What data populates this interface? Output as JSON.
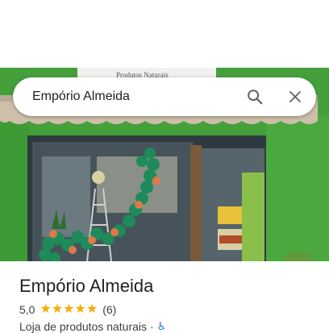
{
  "search": {
    "query": "Empório Almeida",
    "search_icon": "search-icon",
    "close_icon": "close-icon"
  },
  "photo": {
    "sign_text": "Produtos Naturais"
  },
  "place": {
    "name": "Empório Almeida",
    "rating": "5,0",
    "stars": 5,
    "review_count": "(6)",
    "category": "Loja de produtos naturais",
    "separator": "·",
    "accessibility_icon": "wheelchair-icon"
  },
  "colors": {
    "star": "#f9ab00",
    "accessibility": "#1a73e8",
    "wall_green": "#3f8f3a"
  }
}
